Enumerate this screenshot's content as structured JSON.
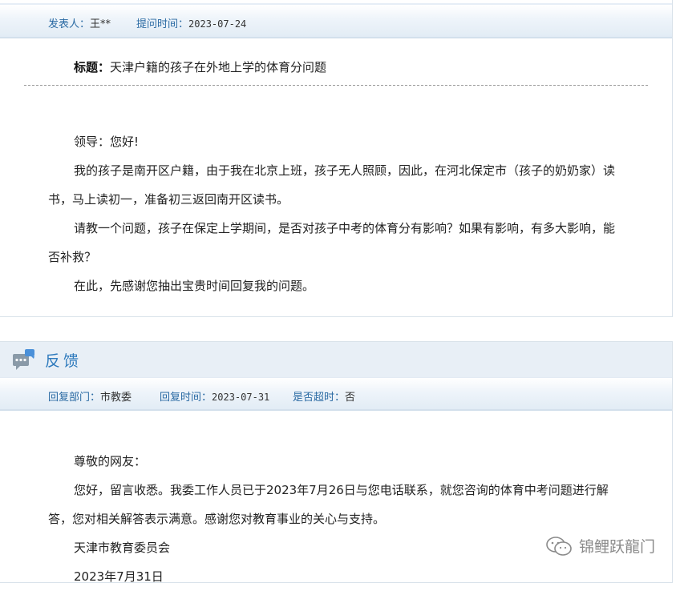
{
  "question": {
    "meta": {
      "poster_label": "发表人：",
      "poster_value": "王**",
      "time_label": "提问时间：",
      "time_value": "2023-07-24"
    },
    "title_label": "标题：",
    "title_value": "天津户籍的孩子在外地上学的体育分问题",
    "paragraphs": [
      "领导：您好!",
      "我的孩子是南开区户籍，由于我在北京上班，孩子无人照顾，因此，在河北保定市（孩子的奶奶家）读书，马上读初一，准备初三返回南开区读书。",
      "请教一个问题，孩子在保定上学期间，是否对孩子中考的体育分有影响？如果有影响，有多大影响，能否补救？",
      "在此，先感谢您抽出宝贵时间回复我的问题。"
    ]
  },
  "feedback": {
    "header_title": "反馈",
    "meta": {
      "dept_label": "回复部门：",
      "dept_value": "市教委",
      "time_label": "回复时间：",
      "time_value": "2023-07-31",
      "overdue_label": "是否超时：",
      "overdue_value": "否"
    },
    "paragraphs": [
      "尊敬的网友：",
      "您好，留言收悉。我委工作人员已于2023年7月26日与您电话联系，就您咨询的体育中考问题进行解答，您对相关解答表示满意。感谢您对教育事业的关心与支持。",
      "天津市教育委员会",
      "2023年7月31日"
    ]
  },
  "watermark": {
    "text": "锦鲤跃龍门",
    "icon": "wechat-icon"
  },
  "colors": {
    "link_blue": "#2a6aa3",
    "header_blue": "#2f7bbd",
    "bar_bg": "#e8eff6"
  }
}
